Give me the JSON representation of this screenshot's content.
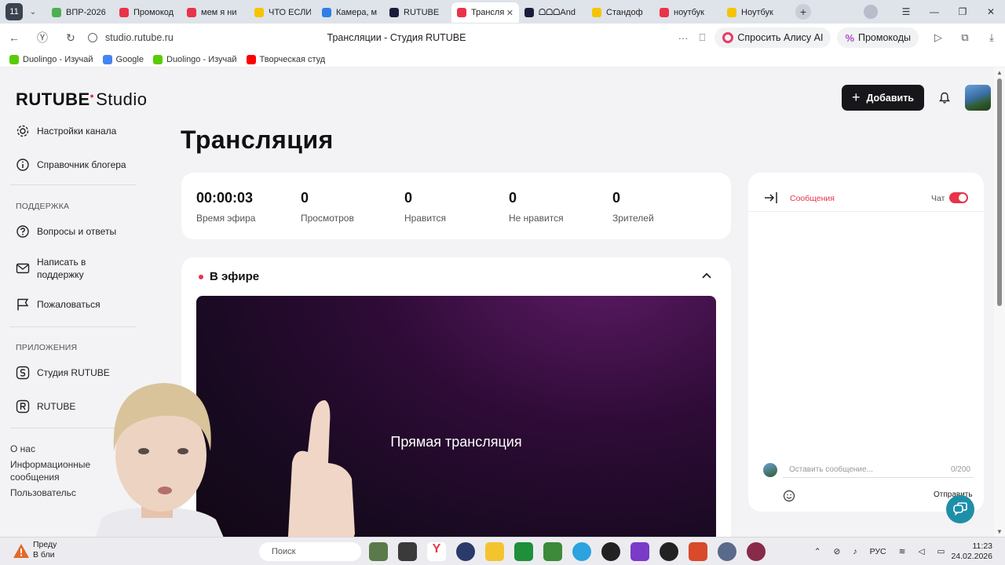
{
  "browser": {
    "tabs": [
      {
        "title": "ВПР-2026",
        "color": "#4caf50",
        "active": false
      },
      {
        "title": "Промокод",
        "color": "#e8334a",
        "active": false
      },
      {
        "title": "мем я ни",
        "color": "#e8334a",
        "active": false
      },
      {
        "title": "ЧТО ЕСЛИ",
        "color": "#f5c400",
        "active": false
      },
      {
        "title": "Камера, м",
        "color": "#2f7ee8",
        "active": false
      },
      {
        "title": "RUTUBE",
        "color": "#1c1c3a",
        "active": false
      },
      {
        "title": "Трансля",
        "color": "#e8334a",
        "active": true
      },
      {
        "title": "ᗝᗝᗝAnd",
        "color": "#1c1c3a",
        "active": false
      },
      {
        "title": "Стандоф",
        "color": "#f5c400",
        "active": false
      },
      {
        "title": "ноутбук",
        "color": "#e8334a",
        "active": false
      },
      {
        "title": "Ноутбук",
        "color": "#f5c400",
        "active": false
      }
    ],
    "url": "studio.rutube.ru",
    "page_title": "Трансляции - Студия RUTUBE",
    "alice_label": "Спросить Алису AI",
    "promo_label": "Промокоды",
    "bookmarks": [
      {
        "label": "Duolingo - Изучай",
        "color": "#58cc02"
      },
      {
        "label": "Google",
        "color": "#4285f4"
      },
      {
        "label": "Duolingo - Изучай",
        "color": "#58cc02"
      },
      {
        "label": "Творческая студ",
        "color": "#ff0000"
      }
    ]
  },
  "header": {
    "logo_main": "RUTUBE",
    "logo_sub": "Studio",
    "add_label": "Добавить"
  },
  "sidebar": {
    "top_items": [
      {
        "label": "Настройки канала",
        "icon": "gear-icon"
      },
      {
        "label": "Справочник блогера",
        "icon": "info-icon"
      }
    ],
    "support_title": "ПОДДЕРЖКА",
    "support_items": [
      {
        "label": "Вопросы и ответы",
        "icon": "question-icon"
      },
      {
        "label": "Написать в поддержку",
        "icon": "mail-icon"
      },
      {
        "label": "Пожаловаться",
        "icon": "flag-icon"
      }
    ],
    "apps_title": "ПРИЛОЖЕНИЯ",
    "apps_items": [
      {
        "label": "Студия RUTUBE",
        "icon": "studio-app-icon"
      },
      {
        "label": "RUTUBE",
        "icon": "rutube-app-icon"
      }
    ],
    "footer": [
      "О нас",
      "Информационные сообщения",
      "Пользовательс"
    ]
  },
  "main": {
    "title": "Трансляция",
    "stats": [
      {
        "value": "00:00:03",
        "label": "Время эфира"
      },
      {
        "value": "0",
        "label": "Просмотров"
      },
      {
        "value": "0",
        "label": "Нравится"
      },
      {
        "value": "0",
        "label": "Не нравится"
      },
      {
        "value": "0",
        "label": "Зрителей"
      }
    ],
    "live_title": "В эфире",
    "player_text": "Прямая трансляция"
  },
  "chat": {
    "tab_label": "Сообщения",
    "toggle_label": "Чат",
    "toggle_on": true,
    "input_placeholder": "Оставить сообщение...",
    "counter": "0/200",
    "send_label": "Отправить"
  },
  "taskbar": {
    "weather_line1": "Преду",
    "weather_line2": "В бли",
    "search_label": "Поиск",
    "lang": "РУС",
    "time": "11:23",
    "date": "24.02.2026"
  },
  "colors": {
    "accent": "#e8334a",
    "dark_button": "#17171b",
    "support_fab": "#1e8fa8"
  }
}
